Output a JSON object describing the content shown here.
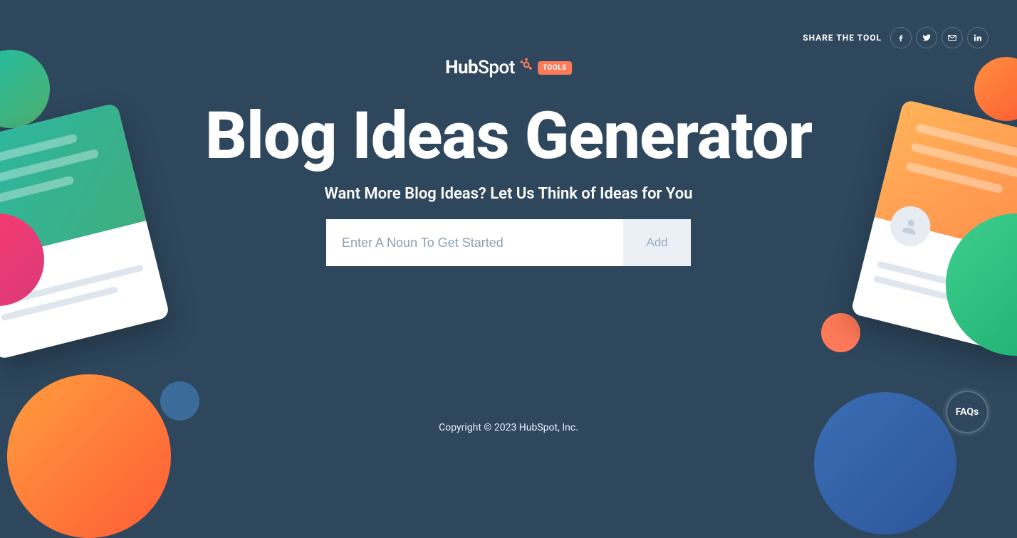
{
  "share": {
    "label": "SHARE THE TOOL",
    "icons": [
      "facebook",
      "twitter",
      "email",
      "linkedin"
    ]
  },
  "logo": {
    "brand_part1": "Hub",
    "brand_part2": "Spot",
    "badge": "TOOLS"
  },
  "hero": {
    "title": "Blog Ideas Generator",
    "subtitle": "Want More Blog Ideas? Let Us Think of Ideas for You"
  },
  "form": {
    "input_placeholder": "Enter A Noun To Get Started",
    "add_label": "Add"
  },
  "footer": {
    "copyright": "Copyright © 2023 HubSpot, Inc."
  },
  "faqs": {
    "label": "FAQs"
  }
}
